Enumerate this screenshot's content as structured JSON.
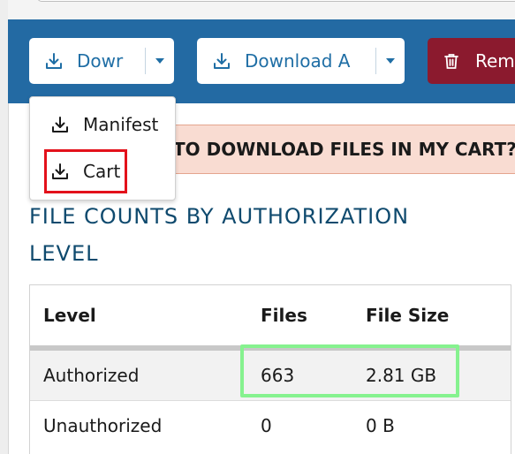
{
  "toolbar": {
    "download_manifest_label": "Dowr",
    "download_all_label": "Download A",
    "remove_label": "Rem"
  },
  "dropdown": {
    "items": [
      {
        "label": "Manifest"
      },
      {
        "label": "Cart"
      }
    ]
  },
  "alert": {
    "text": "TO DOWNLOAD FILES IN MY CART?"
  },
  "section": {
    "heading_line1": "FILE COUNTS BY AUTHORIZATION",
    "heading_line2": "LEVEL"
  },
  "table": {
    "headers": [
      "Level",
      "Files",
      "File Size"
    ],
    "rows": [
      {
        "level": "Authorized",
        "files": "663",
        "size": "2.81 GB"
      },
      {
        "level": "Unauthorized",
        "files": "0",
        "size": "0 B"
      }
    ]
  },
  "colors": {
    "toolbar_bg": "#236aa3",
    "remove_bg": "#8b1a2e",
    "alert_bg": "#f9dcd2",
    "heading": "#0f4a6e",
    "cart_highlight": "#e3111b",
    "value_highlight": "#86f28f"
  },
  "icons": {
    "download": "download-icon",
    "remove": "trash-icon",
    "caret": "chevron-down-icon"
  }
}
